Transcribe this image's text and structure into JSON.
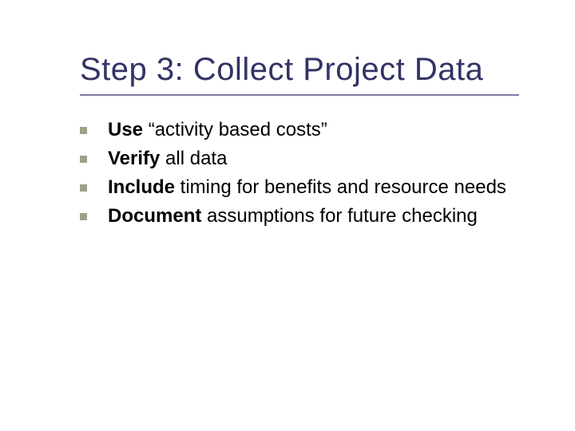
{
  "title": "Step 3: Collect Project Data",
  "bullets": [
    {
      "bold": "Use",
      "rest": " “activity based costs”"
    },
    {
      "bold": "Verify",
      "rest": " all data"
    },
    {
      "bold": "Include",
      "rest": " timing for benefits and resource needs"
    },
    {
      "bold": "Document",
      "rest": " assumptions for future checking"
    }
  ]
}
